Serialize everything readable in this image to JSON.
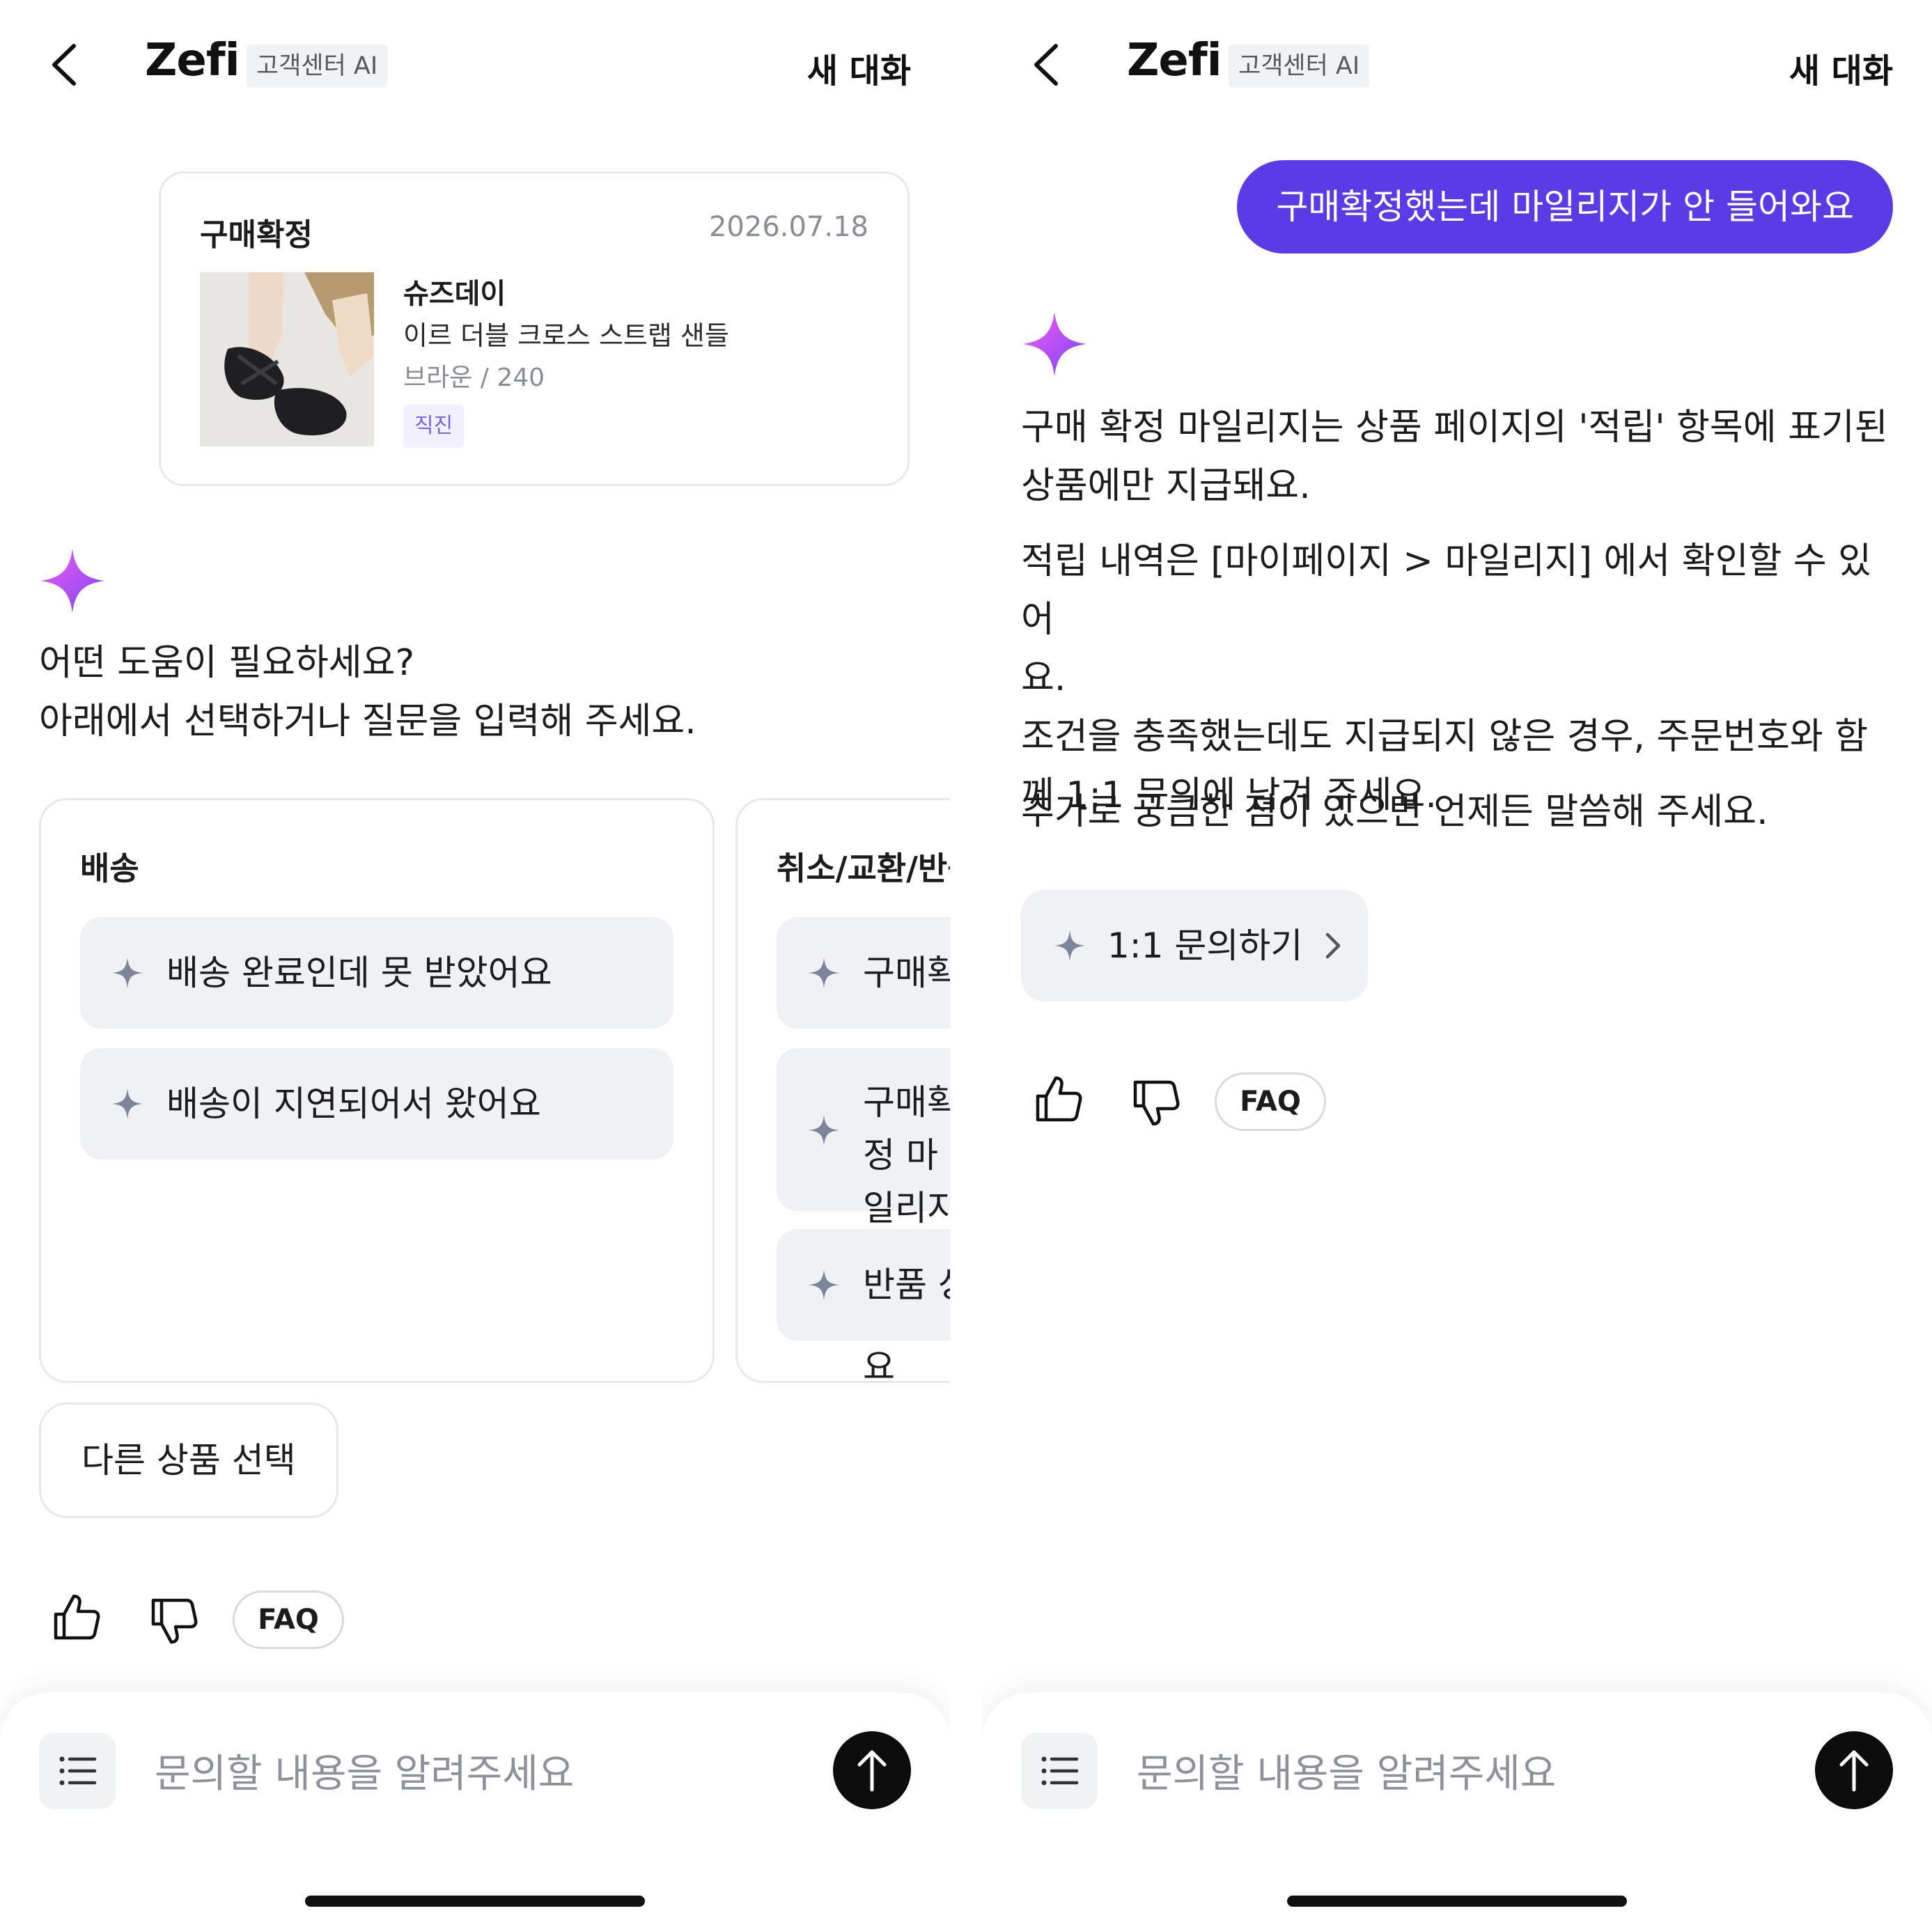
{
  "left": {
    "header": {
      "back_label": "back",
      "logo": "Zefi",
      "badge": "고객센터 AI",
      "new_chat": "새 대화"
    },
    "product_card": {
      "status": "구매확정",
      "date": "2026.07.18",
      "brand": "슈즈데이",
      "name": "이르 더블 크로스 스트랩 샌들",
      "option": "브라운 / 240",
      "tag": "직진"
    },
    "greeting": {
      "line1": "어떤 도움이 필요하세요?",
      "line2": "아래에서 선택하거나 질문을 입력해 주세요."
    },
    "categories": [
      {
        "title": "배송",
        "chips": [
          "배송 완료인데 못 받았어요",
          "배송이 지연되어서 왔어요"
        ]
      },
      {
        "title": "취소/교환/반품",
        "chips": [
          "구매확정",
          "구매확정 마일리지가 안 들어와요",
          "반품 상태"
        ]
      }
    ],
    "other_product": "다른 상품 선택",
    "feedback": {
      "faq": "FAQ"
    },
    "input": {
      "placeholder": "문의할 내용을 알려주세요"
    }
  },
  "right": {
    "header": {
      "logo": "Zefi",
      "badge": "고객센터 AI",
      "new_chat": "새 대화"
    },
    "user_message": "구매확정했는데 마일리지가 안 들어와요",
    "answer": {
      "p1_line1": "구매 확정 마일리지는 상품 페이지의 '적립' 항목에 표기된",
      "p1_line2": "상품에만 지급돼요.",
      "p2_line1": "적립 내역은 [마이페이지 > 마일리지] 에서 확인할 수 있어",
      "p2_line2": "요.",
      "p2_line3": "조건을 충족했는데도 지급되지 않은 경우, 주문번호와 함",
      "p2_line4": "께 1:1 문의에 남겨 주세요.",
      "p3": "추가로 궁금한 점이 있으면 언제든 말씀해 주세요."
    },
    "inquiry_button": "1:1 문의하기",
    "feedback": {
      "faq": "FAQ"
    },
    "input": {
      "placeholder": "문의할 내용을 알려주세요"
    }
  },
  "colors": {
    "accent": "#5a3be6",
    "chip_bg": "#eff1f4",
    "tag_text": "#7b61f0"
  },
  "icons": [
    "back-arrow-icon",
    "ai-sparkle-icon",
    "sparkle-icon",
    "thumbs-up-icon",
    "thumbs-down-icon",
    "menu-list-icon",
    "send-arrow-icon",
    "chevron-right-icon"
  ]
}
